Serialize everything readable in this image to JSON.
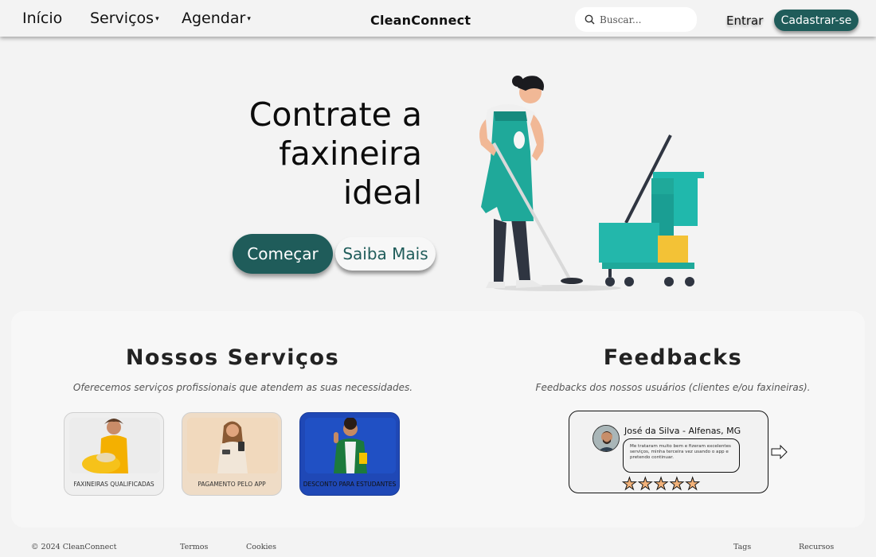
{
  "nav": {
    "home": "Início",
    "services": "Serviços",
    "schedule": "Agendar",
    "brand": "CleanConnect",
    "search_placeholder": "Buscar...",
    "login": "Entrar",
    "signup": "Cadastrar-se"
  },
  "hero": {
    "title_line1": "Contrate a",
    "title_line2": "faxineira",
    "title_line3": "ideal",
    "start_button": "Começar",
    "more_button": "Saiba Mais"
  },
  "services": {
    "title": "Nossos Serviços",
    "subtitle": "Oferecemos serviços profissionais que atendem as suas necessidades.",
    "cards": [
      {
        "label": "FAXINEIRAS QUALIFICADAS"
      },
      {
        "label": "PAGAMENTO PELO APP"
      },
      {
        "label": "DESCONTO PARA ESTUDANTES"
      }
    ]
  },
  "feedbacks": {
    "title": "Feedbacks",
    "subtitle": "Feedbacks dos nossos usuários (clientes e/ou faxineiras).",
    "author": "José da Silva - Alfenas, MG",
    "text": "Me trataram muito bem e fizeram excelentes serviços, minha terceira vez usando o app e pretendo continuar.",
    "stars": "★★★★★",
    "rating": 5
  },
  "footer": {
    "copyright": "© 2024 CleanConnect",
    "terms": "Termos",
    "cookies": "Cookies",
    "tags": "Tags",
    "resources": "Recursos"
  },
  "colors": {
    "accent": "#1f5c5a",
    "background": "#f3f3f3",
    "star": "#f2b27a",
    "student_card": "#1f48b6"
  }
}
